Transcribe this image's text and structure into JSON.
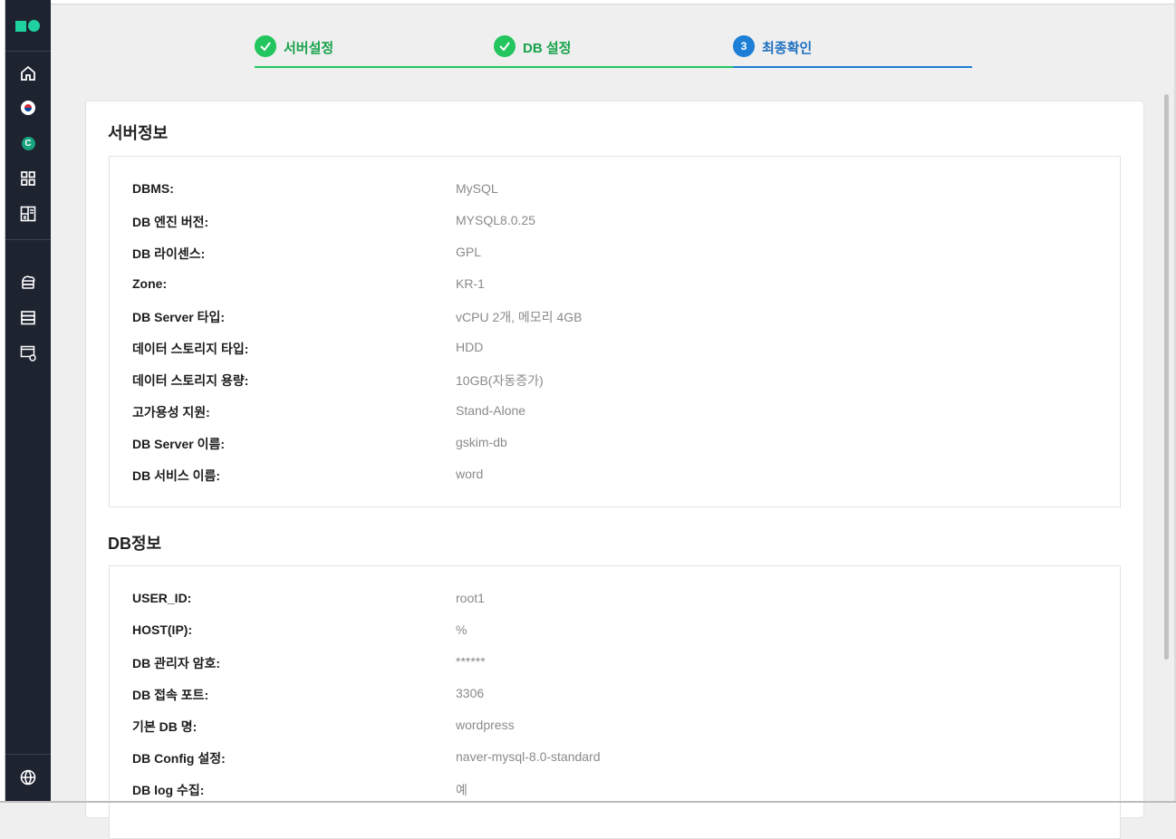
{
  "sidebar": {
    "icons": [
      "logo",
      "home-icon",
      "korea-flag-icon",
      "c-badge-icon",
      "grid-icon",
      "dashboard-icon",
      "cloud-db-icon",
      "server-icon",
      "db-monitor-icon",
      "globe-icon"
    ],
    "badge_letter": "C"
  },
  "stepper": {
    "steps": [
      {
        "label": "서버설정",
        "status": "done"
      },
      {
        "label": "DB 설정",
        "status": "done"
      },
      {
        "number": "3",
        "label": "최종확인",
        "status": "active"
      }
    ],
    "colors": {
      "done": "#22c55e",
      "active": "#1e7fd6"
    }
  },
  "server_info": {
    "title": "서버정보",
    "rows": [
      {
        "key": "DBMS:",
        "value": "MySQL"
      },
      {
        "key": "DB 엔진 버전:",
        "value": "MYSQL8.0.25"
      },
      {
        "key": "DB 라이센스:",
        "value": "GPL"
      },
      {
        "key": "Zone:",
        "value": "KR-1"
      },
      {
        "key": "DB Server 타입:",
        "value": "vCPU 2개, 메모리 4GB"
      },
      {
        "key": "데이터 스토리지 타입:",
        "value": "HDD"
      },
      {
        "key": "데이터 스토리지 용량:",
        "value": "10GB(자동증가)"
      },
      {
        "key": "고가용성 지원:",
        "value": "Stand-Alone"
      },
      {
        "key": "DB Server 이름:",
        "value": "gskim-db"
      },
      {
        "key": "DB 서비스 이름:",
        "value": "word"
      }
    ]
  },
  "db_info": {
    "title": "DB정보",
    "rows": [
      {
        "key": "USER_ID:",
        "value": "root1"
      },
      {
        "key": "HOST(IP):",
        "value": "%"
      },
      {
        "key": "DB 관리자 암호:",
        "value": "******"
      },
      {
        "key": "DB 접속 포트:",
        "value": "3306"
      },
      {
        "key": "기본 DB 명:",
        "value": "wordpress"
      },
      {
        "key": "DB Config 설정:",
        "value": "naver-mysql-8.0-standard"
      },
      {
        "key": "DB log 수집:",
        "value": "예"
      }
    ]
  }
}
